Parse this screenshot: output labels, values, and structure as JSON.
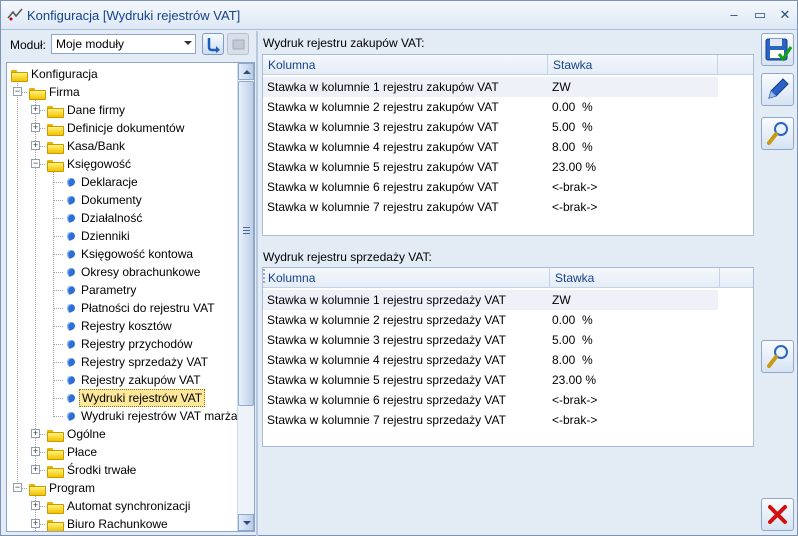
{
  "window": {
    "title": "Konfiguracja [Wydruki rejestrów VAT]",
    "controls": [
      "–",
      "▭",
      "✕"
    ]
  },
  "module": {
    "label": "Moduł:",
    "value": "Moje moduły"
  },
  "tree": [
    {
      "label": "Konfiguracja",
      "type": "folder"
    },
    {
      "label": "Firma",
      "type": "folder"
    },
    {
      "label": "Dane firmy",
      "type": "folder"
    },
    {
      "label": "Definicje dokumentów",
      "type": "folder"
    },
    {
      "label": "Kasa/Bank",
      "type": "folder"
    },
    {
      "label": "Księgowość",
      "type": "folder"
    },
    {
      "label": "Deklaracje",
      "type": "leaf"
    },
    {
      "label": "Dokumenty",
      "type": "leaf"
    },
    {
      "label": "Działalność",
      "type": "leaf"
    },
    {
      "label": "Dzienniki",
      "type": "leaf"
    },
    {
      "label": "Księgowość kontowa",
      "type": "leaf"
    },
    {
      "label": "Okresy obrachunkowe",
      "type": "leaf"
    },
    {
      "label": "Parametry",
      "type": "leaf"
    },
    {
      "label": "Płatności do rejestru VAT",
      "type": "leaf"
    },
    {
      "label": "Rejestry kosztów",
      "type": "leaf"
    },
    {
      "label": "Rejestry przychodów",
      "type": "leaf"
    },
    {
      "label": "Rejestry sprzedaży VAT",
      "type": "leaf"
    },
    {
      "label": "Rejestry zakupów VAT",
      "type": "leaf"
    },
    {
      "label": "Wydruki rejestrów VAT",
      "type": "leaf",
      "selected": true
    },
    {
      "label": "Wydruki rejestrów VAT marża",
      "type": "leaf"
    },
    {
      "label": "Ogólne",
      "type": "folder"
    },
    {
      "label": "Płace",
      "type": "folder"
    },
    {
      "label": "Środki trwałe",
      "type": "folder"
    },
    {
      "label": "Program",
      "type": "folder"
    },
    {
      "label": "Automat synchronizacji",
      "type": "folder"
    },
    {
      "label": "Biuro Rachunkowe",
      "type": "folder"
    }
  ],
  "purchase": {
    "title": "Wydruk rejestru zakupów VAT:",
    "headers": [
      "Kolumna",
      "Stawka"
    ],
    "rows": [
      [
        "Stawka w kolumnie 1 rejestru zakupów VAT",
        "ZW"
      ],
      [
        "Stawka w kolumnie 2 rejestru zakupów VAT",
        "0.00  %"
      ],
      [
        "Stawka w kolumnie 3 rejestru zakupów VAT",
        "5.00  %"
      ],
      [
        "Stawka w kolumnie 4 rejestru zakupów VAT",
        "8.00  %"
      ],
      [
        "Stawka w kolumnie 5 rejestru zakupów VAT",
        "23.00 %"
      ],
      [
        "Stawka w kolumnie 6 rejestru zakupów VAT",
        "<-brak->"
      ],
      [
        "Stawka w kolumnie 7 rejestru zakupów VAT",
        "<-brak->"
      ]
    ]
  },
  "sales": {
    "title": "Wydruk rejestru sprzedaży VAT:",
    "headers": [
      "Kolumna",
      "Stawka"
    ],
    "rows": [
      [
        "Stawka w kolumnie 1 rejestru sprzedaży VAT",
        "ZW"
      ],
      [
        "Stawka w kolumnie 2 rejestru sprzedaży VAT",
        "0.00  %"
      ],
      [
        "Stawka w kolumnie 3 rejestru sprzedaży VAT",
        "5.00  %"
      ],
      [
        "Stawka w kolumnie 4 rejestru sprzedaży VAT",
        "8.00  %"
      ],
      [
        "Stawka w kolumnie 5 rejestru sprzedaży VAT",
        "23.00 %"
      ],
      [
        "Stawka w kolumnie 6 rejestru sprzedaży VAT",
        "<-brak->"
      ],
      [
        "Stawka w kolumnie 7 rejestru sprzedaży VAT",
        "<-brak->"
      ]
    ]
  },
  "icons": {
    "save": "save-icon",
    "edit": "edit-icon",
    "preview": "magnifier-icon",
    "close": "close-icon"
  },
  "colors": {
    "accent": "#15428b",
    "selection": "#fce89a",
    "close": "#d01010"
  }
}
